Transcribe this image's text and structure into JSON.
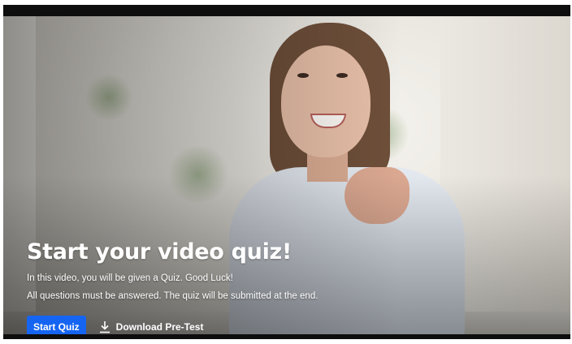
{
  "quiz": {
    "title": "Start your video quiz!",
    "line1": "In this video, you will be given a Quiz. Good Luck!",
    "line2": "All questions must be answered. The quiz will be submitted at the end."
  },
  "actions": {
    "start_label": "Start Quiz",
    "download_label": "Download Pre-Test",
    "download_icon": "download-icon"
  },
  "colors": {
    "start_button": "#1565f2",
    "text": "#ffffff",
    "letterbox": "#0e0e0e"
  }
}
